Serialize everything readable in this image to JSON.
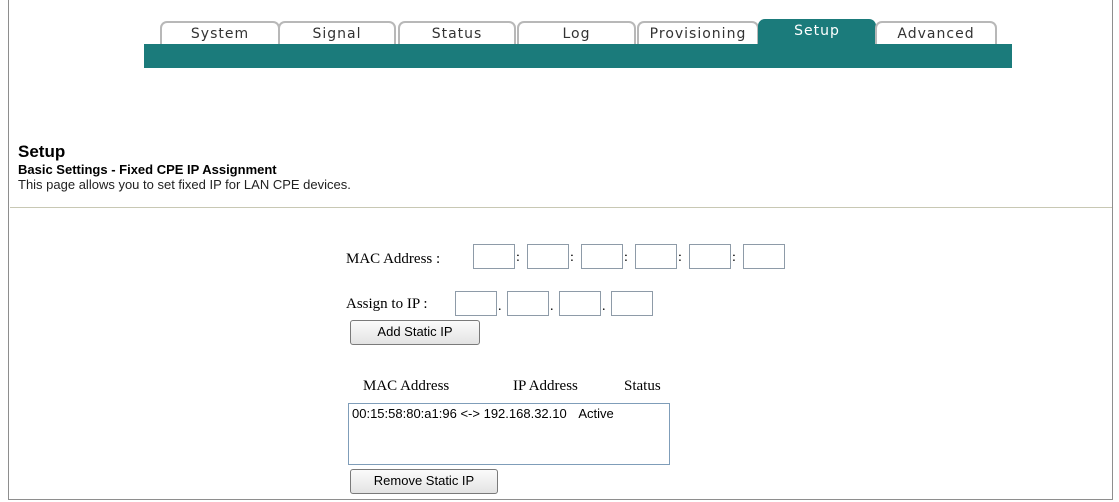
{
  "tabs": [
    {
      "label": "System",
      "active": false
    },
    {
      "label": "Signal",
      "active": false
    },
    {
      "label": "Status",
      "active": false
    },
    {
      "label": "Log",
      "active": false
    },
    {
      "label": "Provisioning",
      "active": false
    },
    {
      "label": "Setup",
      "active": true
    },
    {
      "label": "Advanced",
      "active": false
    }
  ],
  "colors": {
    "accent": "#1b7b7b"
  },
  "page": {
    "title": "Setup",
    "subtitle": "Basic Settings - Fixed CPE IP Assignment",
    "description": "This page allows you to set fixed IP for LAN CPE devices."
  },
  "form": {
    "mac_label": "MAC Address :",
    "mac_values": [
      "",
      "",
      "",
      "",
      "",
      ""
    ],
    "mac_separator": ":",
    "ip_label": "Assign to IP :",
    "ip_values": [
      "",
      "",
      "",
      ""
    ],
    "ip_separator": ".",
    "add_button": "Add Static IP"
  },
  "list": {
    "headers": {
      "mac": "MAC Address",
      "ip": "IP Address",
      "status": "Status"
    },
    "entries": [
      {
        "mac": "00:15:58:80:a1:96",
        "arrow": "<->",
        "ip": "192.168.32.10",
        "status": "Active"
      }
    ],
    "remove_button": "Remove Static IP"
  }
}
